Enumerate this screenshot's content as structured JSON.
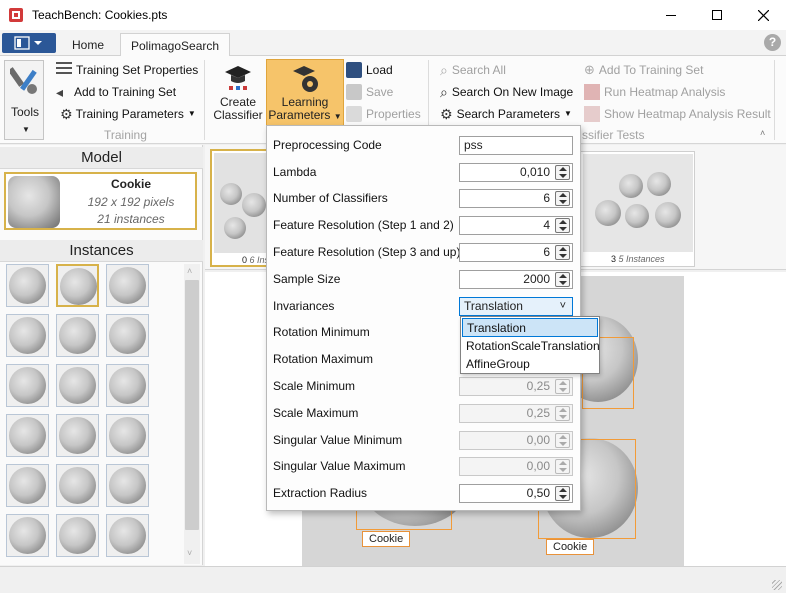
{
  "window": {
    "title": "TeachBench: Cookies.pts"
  },
  "tabs": [
    {
      "label": "Home"
    },
    {
      "label": "PolimagoSearch"
    }
  ],
  "ribbon": {
    "tools": {
      "label": "Tools"
    },
    "training": {
      "group_label": "Training",
      "set_properties": "Training Set Properties",
      "add_to_set": "Add to Training Set",
      "parameters": "Training Parameters"
    },
    "create_classifier": {
      "line1": "Create",
      "line2": "Classifier"
    },
    "learning_params": {
      "line1": "Learning",
      "line2": "Parameters"
    },
    "file": {
      "load": "Load",
      "save": "Save",
      "properties": "Properties"
    },
    "search": {
      "all": "Search All",
      "new_image": "Search On New Image",
      "parameters": "Search Parameters"
    },
    "classifier_tests": {
      "group_label": "ssifier Tests",
      "add_to_set": "Add To Training Set",
      "run_heatmap": "Run Heatmap Analysis",
      "show_heatmap": "Show Heatmap Analysis Result"
    }
  },
  "model": {
    "header": "Model",
    "name": "Cookie",
    "size": "192 x 192 pixels",
    "instances": "21 instances"
  },
  "instances_header": "Instances",
  "image_strip": [
    {
      "index": "0",
      "label": "6 Ins"
    },
    {
      "index": "3",
      "label": "5 Instances"
    }
  ],
  "learning_panel": {
    "rows": [
      {
        "label": "Preprocessing Code",
        "value": "pss",
        "kind": "text"
      },
      {
        "label": "Lambda",
        "value": "0,010",
        "kind": "num"
      },
      {
        "label": "Number of Classifiers",
        "value": "6",
        "kind": "num"
      },
      {
        "label": "Feature Resolution (Step 1 and 2)",
        "value": "4",
        "kind": "num"
      },
      {
        "label": "Feature Resolution (Step 3 and up)",
        "value": "6",
        "kind": "num"
      },
      {
        "label": "Sample Size",
        "value": "2000",
        "kind": "num"
      },
      {
        "label": "Invariances",
        "value": "Translation",
        "kind": "select"
      },
      {
        "label": "Rotation Minimum",
        "value": "",
        "kind": "hidden"
      },
      {
        "label": "Rotation Maximum",
        "value": "",
        "kind": "hidden"
      },
      {
        "label": "Scale Minimum",
        "value": "0,25",
        "kind": "num-dis"
      },
      {
        "label": "Scale Maximum",
        "value": "0,25",
        "kind": "num-dis"
      },
      {
        "label": "Singular Value Minimum",
        "value": "0,00",
        "kind": "num-dis"
      },
      {
        "label": "Singular Value Maximum",
        "value": "0,00",
        "kind": "num-dis"
      },
      {
        "label": "Extraction Radius",
        "value": "0,50",
        "kind": "num"
      }
    ],
    "invariance_options": [
      "Translation",
      "RotationScaleTranslation",
      "AffineGroup"
    ],
    "selected_option": "Translation"
  },
  "detections": [
    {
      "label": "Cookie"
    },
    {
      "label": "Cookie"
    }
  ],
  "colors": {
    "accent": "#2b5797",
    "highlight": "#f6c46a",
    "detection": "#f29b38",
    "selection": "#cce4f7"
  }
}
